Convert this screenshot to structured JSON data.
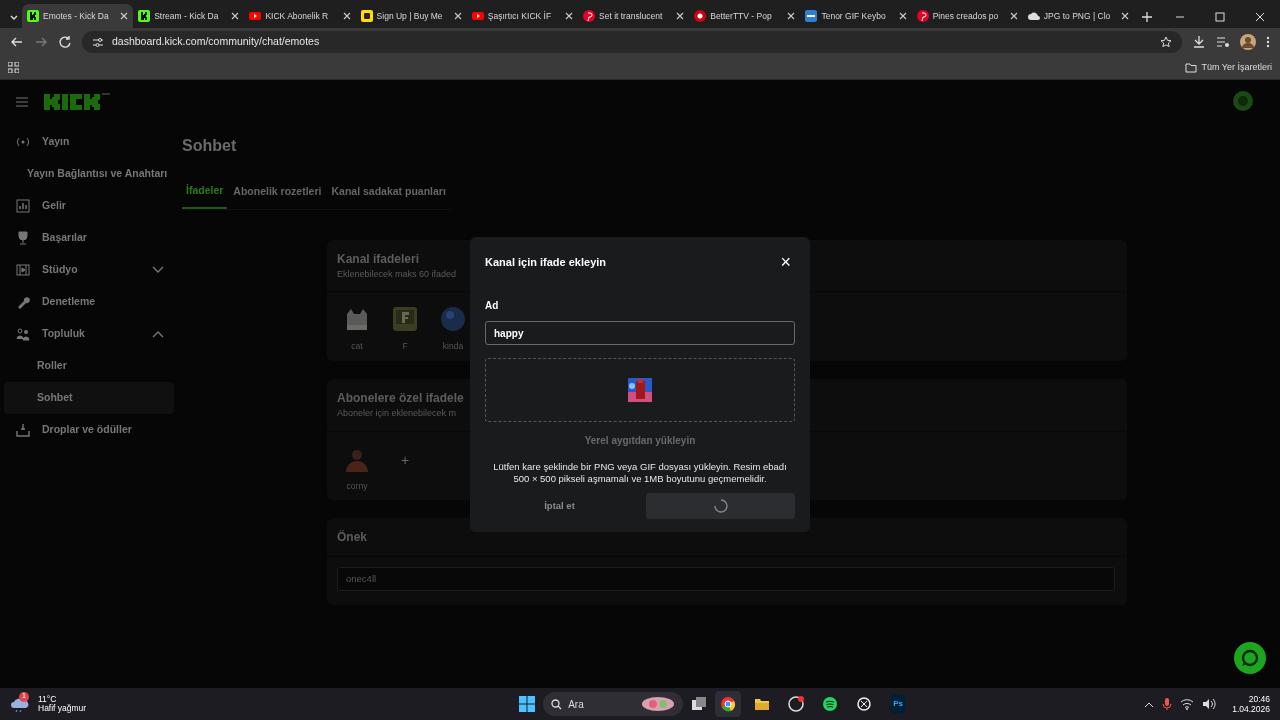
{
  "browser": {
    "tabs": [
      {
        "title": "Emotes - Kick Da",
        "selected": true
      },
      {
        "title": "Stream - Kick Da",
        "selected": false
      },
      {
        "title": "KICK Abonelik R",
        "selected": false
      },
      {
        "title": "Sign Up | Buy Me",
        "selected": false
      },
      {
        "title": "Şaşırtıcı KICK İF",
        "selected": false
      },
      {
        "title": "Set it translucent",
        "selected": false
      },
      {
        "title": "BetterTTV - Pop",
        "selected": false
      },
      {
        "title": "Tenor GIF Keybo",
        "selected": false
      },
      {
        "title": "Pines creados po",
        "selected": false
      },
      {
        "title": "JPG to PNG | Clo",
        "selected": false
      }
    ],
    "address": "dashboard.kick.com/community/chat/emotes",
    "bookmarks_folder": "Tüm Yer İşaretleri"
  },
  "sidebar": {
    "items": [
      {
        "label": "Yayın",
        "selected": false,
        "children": [
          {
            "label": "Yayın Bağlantısı ve Anahtarı",
            "selected": false
          }
        ]
      },
      {
        "label": "Gelir",
        "selected": false
      },
      {
        "label": "Başarılar",
        "selected": false
      },
      {
        "label": "Stüdyo",
        "selected": false,
        "expanded": false
      },
      {
        "label": "Denetleme",
        "selected": false
      },
      {
        "label": "Topluluk",
        "selected": false,
        "expanded": true,
        "children": [
          {
            "label": "Roller",
            "selected": false
          },
          {
            "label": "Sohbet",
            "selected": true
          }
        ]
      },
      {
        "label": "Droplar ve ödüller",
        "selected": false
      }
    ]
  },
  "page": {
    "title": "Sohbet",
    "tabs": [
      {
        "label": "İfadeler",
        "selected": true
      },
      {
        "label": "Abonelik rozetleri",
        "selected": false
      },
      {
        "label": "Kanal sadakat puanları",
        "selected": false
      }
    ],
    "sections": [
      {
        "title": "Kanal ifadeleri",
        "subtitle": "Eklenebilecek maks 60 ifaded",
        "emotes": [
          {
            "kind": "emote",
            "name": "cat"
          },
          {
            "kind": "emote",
            "name": "F"
          },
          {
            "kind": "emote",
            "name": "kinda"
          }
        ]
      },
      {
        "title": "Abonelere özel ifadele",
        "subtitle": "Aboneler için eklenebilecek m",
        "emotes": [
          {
            "kind": "emote",
            "name": "corny"
          },
          {
            "kind": "add",
            "name": "+"
          }
        ]
      }
    ],
    "prefix": {
      "title": "Önek",
      "value": "onec4ll"
    }
  },
  "dialog": {
    "title": "Kanal için ifade ekleyin",
    "close": "×",
    "name_label": "Ad",
    "name_value": "happy",
    "upload_button": "Yerel aygıtdan yükleyin",
    "help": "Lütfen kare şeklinde bir PNG veya GIF dosyası yükleyin. Resim ebadı 500 × 500 pikseli aşmamalı ve 1MB boyutunu geçmemelidir.",
    "cancel": "İptal et",
    "submit_loading": true
  },
  "taskbar": {
    "temperature": "11°C",
    "weather": "Hafif yağmur",
    "weather_badge": "1",
    "search": "Ara",
    "time": "20:46",
    "date": "1.04.2026",
    "apps": [
      {
        "selected": true
      },
      {
        "selected": false
      },
      {
        "selected": false
      },
      {
        "selected": false
      },
      {
        "selected": false
      },
      {
        "label": "Ps",
        "selected": false
      }
    ]
  }
}
